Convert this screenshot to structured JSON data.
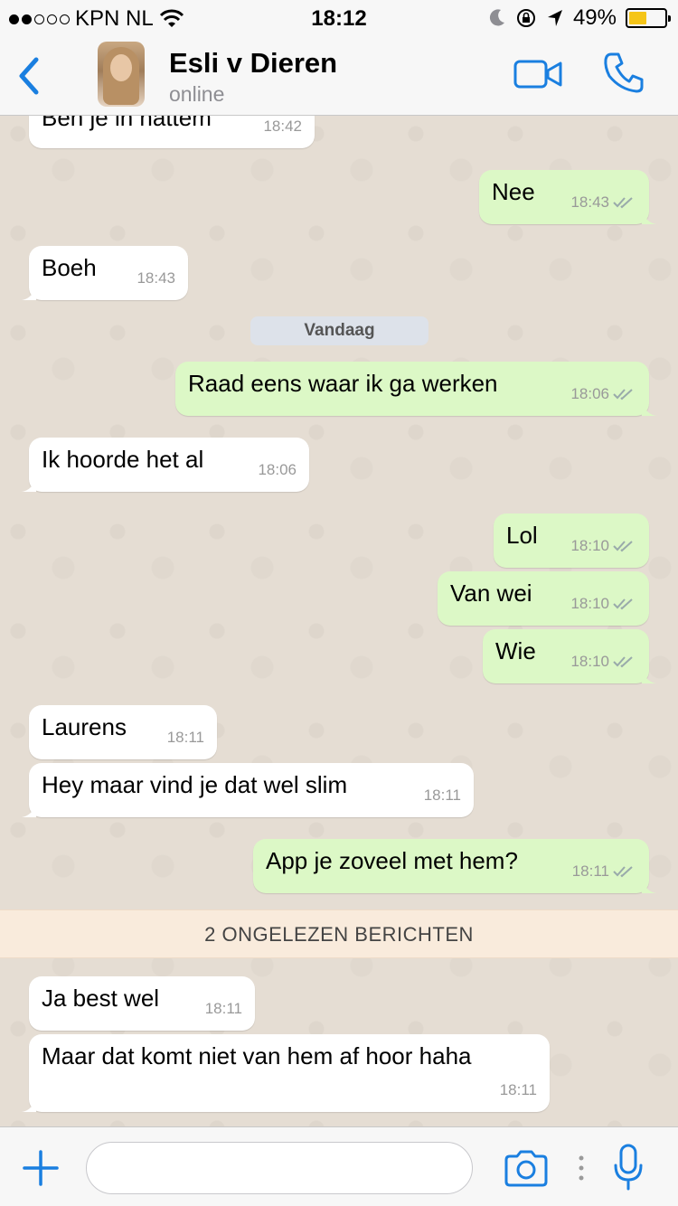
{
  "status_bar": {
    "carrier": "KPN NL",
    "time": "18:12",
    "battery": "49%",
    "battery_level": 0.49
  },
  "header": {
    "contact_name": "Esli v Dieren",
    "contact_status": "online"
  },
  "chat": {
    "date_divider": "Vandaag",
    "unread_banner": "2 ONGELEZEN BERICHTEN",
    "messages": [
      {
        "dir": "in",
        "text": "Ben je in hattem",
        "time": "18:42"
      },
      {
        "dir": "out",
        "text": "Nee",
        "time": "18:43"
      },
      {
        "dir": "in",
        "text": "Boeh",
        "time": "18:43"
      },
      {
        "dir": "out",
        "text": "Raad eens waar ik ga werken",
        "time": "18:06"
      },
      {
        "dir": "in",
        "text": "Ik hoorde het al",
        "time": "18:06"
      },
      {
        "dir": "out",
        "text": "Lol",
        "time": "18:10"
      },
      {
        "dir": "out",
        "text": "Van wei",
        "time": "18:10"
      },
      {
        "dir": "out",
        "text": "Wie",
        "time": "18:10"
      },
      {
        "dir": "in",
        "text": "Laurens",
        "time": "18:11"
      },
      {
        "dir": "in",
        "text": "Hey maar vind je dat wel slim",
        "time": "18:11"
      },
      {
        "dir": "out",
        "text": "App je zoveel met hem?",
        "time": "18:11"
      },
      {
        "dir": "in",
        "text": "Ja best wel",
        "time": "18:11"
      },
      {
        "dir": "in",
        "text": "Maar dat komt niet van hem af hoor haha",
        "time": "18:11"
      }
    ]
  },
  "input": {
    "value": "",
    "placeholder": ""
  },
  "colors": {
    "accent": "#1a7fe0",
    "outgoing_bubble": "#dcf8c6",
    "incoming_bubble": "#ffffff",
    "chat_background": "#e5ddd3",
    "unread_banner": "#f9ebdc"
  },
  "icons": [
    "signal-dots-icon",
    "wifi-icon",
    "moon-icon",
    "rotation-lock-icon",
    "location-arrow-icon",
    "battery-icon",
    "back-chevron-icon",
    "video-call-icon",
    "phone-icon",
    "read-ticks-icon",
    "plus-icon",
    "camera-icon",
    "mic-icon"
  ]
}
